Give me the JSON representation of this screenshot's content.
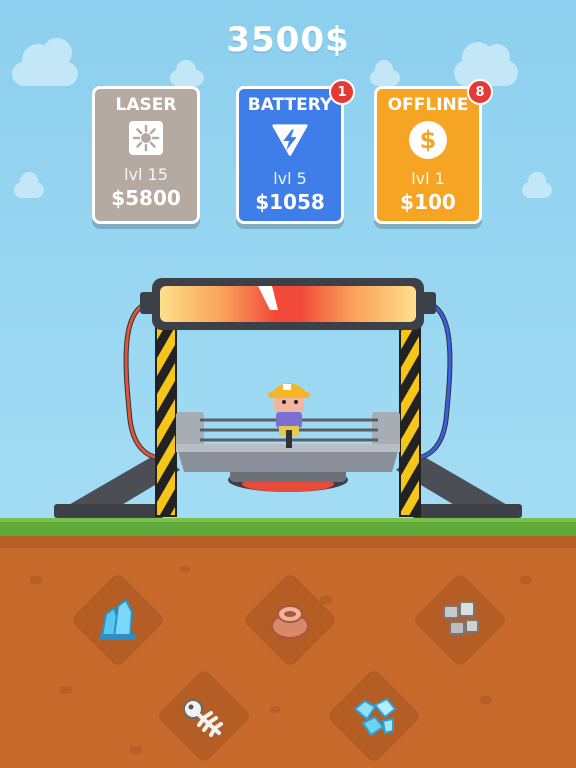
{
  "header": {
    "money": "3500$"
  },
  "cards": [
    {
      "title": "LASER",
      "level": "lvl 15",
      "price": "$5800",
      "icon": "laser-icon",
      "color": "#b5aaa2"
    },
    {
      "title": "BATTERY",
      "level": "lvl 5",
      "price": "$1058",
      "icon": "lightning-icon",
      "color": "#3f7de8",
      "badge": "1"
    },
    {
      "title": "OFFLINE",
      "level": "lvl 1",
      "price": "$100",
      "icon": "dollar-coin-icon",
      "color": "#f6a424",
      "badge": "8"
    }
  ],
  "ores": [
    {
      "name": "blue-crystal-icon"
    },
    {
      "name": "clay-pot-icon"
    },
    {
      "name": "stone-cubes-icon"
    },
    {
      "name": "fish-bone-icon"
    },
    {
      "name": "diamond-shards-icon"
    }
  ],
  "colors": {
    "sky": "#8ccfee",
    "grass": "#5ea93a",
    "dirt": "#c86a2c",
    "badge": "#e53935"
  }
}
